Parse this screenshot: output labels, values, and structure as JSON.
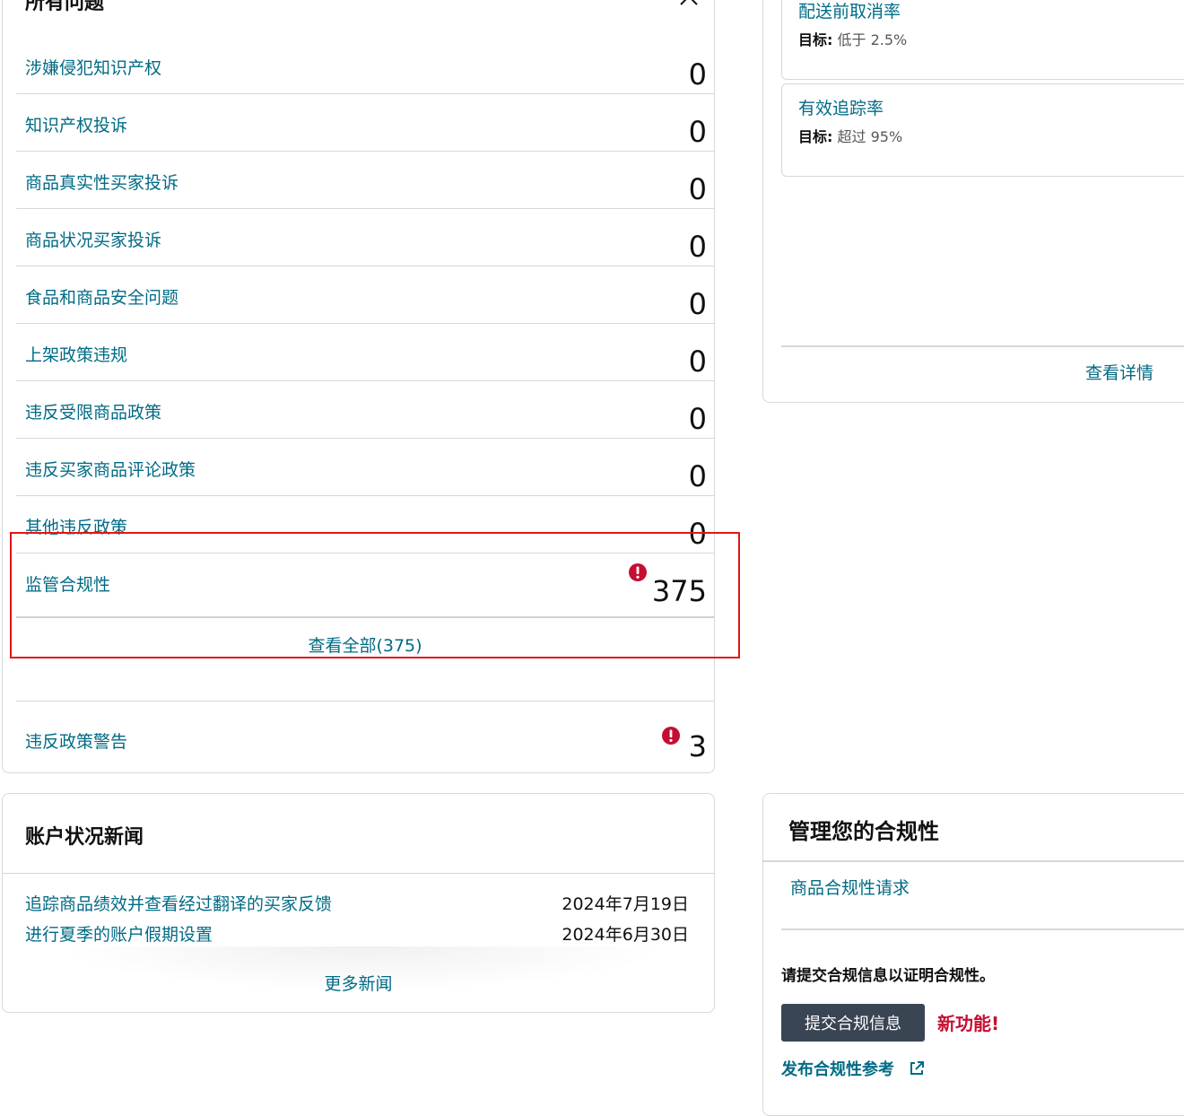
{
  "issues": {
    "title": "所有问题",
    "rows": [
      {
        "label": "涉嫌侵犯知识产权",
        "count": "0"
      },
      {
        "label": "知识产权投诉",
        "count": "0"
      },
      {
        "label": "商品真实性买家投诉",
        "count": "0"
      },
      {
        "label": "商品状况买家投诉",
        "count": "0"
      },
      {
        "label": "食品和商品安全问题",
        "count": "0"
      },
      {
        "label": "上架政策违规",
        "count": "0"
      },
      {
        "label": "违反受限商品政策",
        "count": "0"
      },
      {
        "label": "违反买家商品评论政策",
        "count": "0"
      },
      {
        "label": "其他违反政策",
        "count": "0"
      },
      {
        "label": "监管合规性",
        "count": "375"
      }
    ],
    "view_all": "查看全部(375)",
    "warnings": {
      "label": "违反政策警告",
      "count": "3"
    }
  },
  "metrics": {
    "items": [
      {
        "title": "配送前取消率",
        "target_label": "目标:",
        "target_value": "低于 2.5%"
      },
      {
        "title": "有效追踪率",
        "target_label": "目标:",
        "target_value": "超过 95%"
      }
    ],
    "view_details": "查看详情"
  },
  "news": {
    "title": "账户状况新闻",
    "items": [
      {
        "title": "追踪商品绩效并查看经过翻译的买家反馈",
        "date": "2024年7月19日"
      },
      {
        "title": "进行夏季的账户假期设置",
        "date": "2024年6月30日"
      }
    ],
    "more": "更多新闻"
  },
  "compliance": {
    "title": "管理您的合规性",
    "request_link": "商品合规性请求",
    "prompt": "请提交合规信息以证明合规性。",
    "submit_button": "提交合规信息",
    "new_badge": "新功能!",
    "publish_link": "发布合规性参考"
  },
  "colors": {
    "link": "#006b85",
    "alert": "#c40f32",
    "highlight": "#e41515",
    "button": "#3a4554"
  },
  "icons": [
    "chevron-up-icon",
    "alert-icon",
    "external-link-icon"
  ]
}
